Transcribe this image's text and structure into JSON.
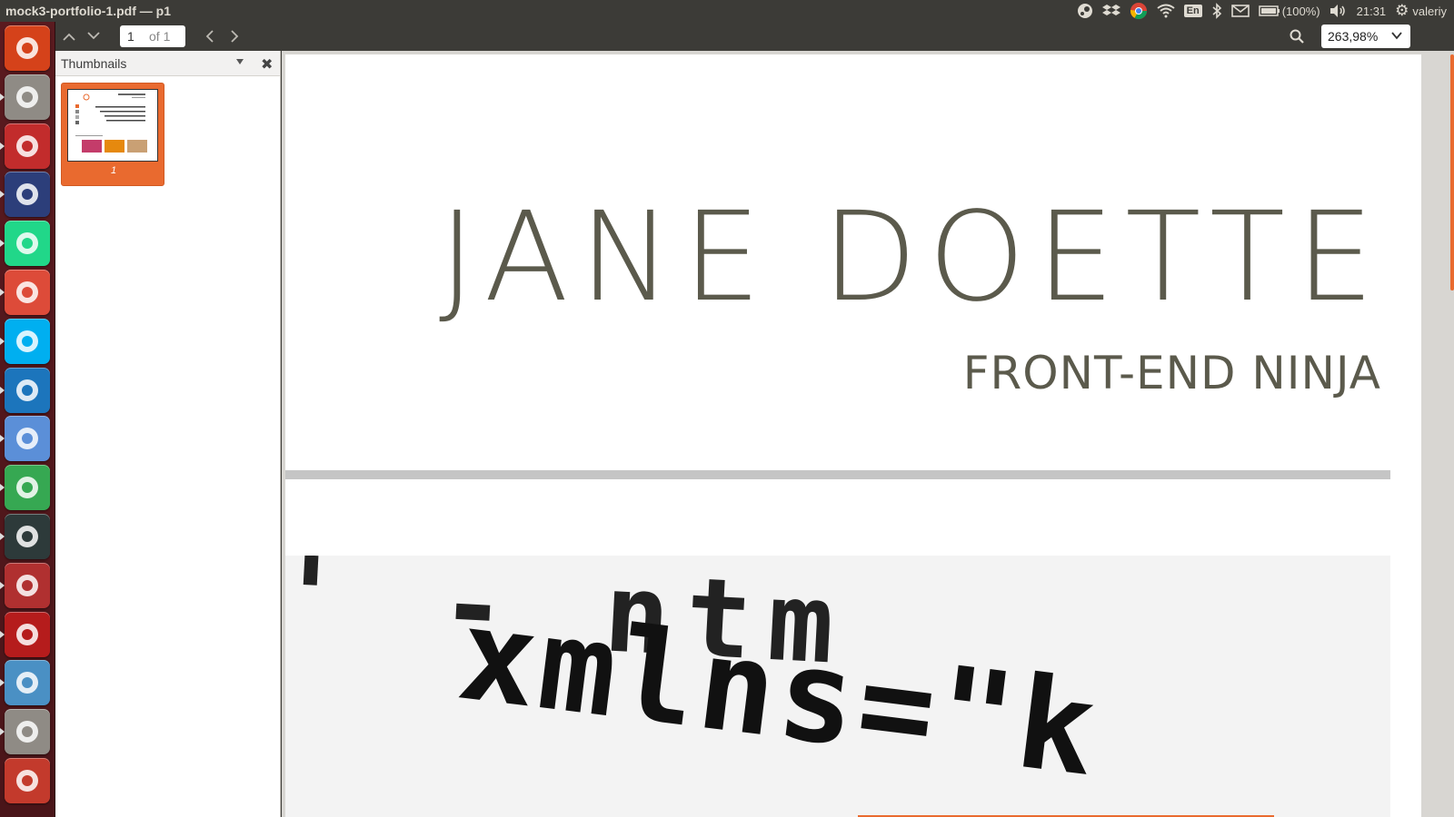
{
  "window": {
    "title": "mock3-portfolio-1.pdf — p1"
  },
  "panel": {
    "keyboard_layout": "En",
    "battery_text": "(100%)",
    "clock": "21:31",
    "user": "valeriy"
  },
  "toolbar": {
    "page_current": "1",
    "page_total": "of 1",
    "zoom": "263,98%"
  },
  "sidebar": {
    "title": "Thumbnails",
    "thumbnails": [
      {
        "label": "1"
      }
    ]
  },
  "document": {
    "name": "JANE DOETTE",
    "subtitle": "FRONT-END NINJA",
    "code_lines": [
      {
        "text": "' -   ntm"
      },
      {
        "text": "xmlns=\"k"
      }
    ]
  },
  "launcher": {
    "items": [
      {
        "name": "ubuntu-dash-icon",
        "color": "#d5421a"
      },
      {
        "name": "files-icon",
        "color": "#8f8b85"
      },
      {
        "name": "system-settings-icon",
        "color": "#c22c2c"
      },
      {
        "name": "password-manager-icon",
        "color": "#2c3e7a"
      },
      {
        "name": "pycharm-icon",
        "color": "#21d789"
      },
      {
        "name": "chrome-icon",
        "color": "#dd4b39"
      },
      {
        "name": "skype-icon",
        "color": "#00aff0"
      },
      {
        "name": "cloud-storage-icon",
        "color": "#1c75bc"
      },
      {
        "name": "chromium-icon",
        "color": "#5b8fd8"
      },
      {
        "name": "network-app-icon",
        "color": "#36a852"
      },
      {
        "name": "system-monitor-icon",
        "color": "#2d3a3a"
      },
      {
        "name": "tools-icon",
        "color": "#b03030"
      },
      {
        "name": "fire-app-icon",
        "color": "#b51c1c"
      },
      {
        "name": "mysql-workbench-icon",
        "color": "#4a90c4"
      },
      {
        "name": "text-editor-icon",
        "color": "#8f8b85"
      },
      {
        "name": "document-viewer-icon",
        "color": "#c33a2c"
      }
    ]
  },
  "colors": {
    "accent": "#e96a2f",
    "heading": "#5b5a4c",
    "panel": "#3c3b37"
  }
}
